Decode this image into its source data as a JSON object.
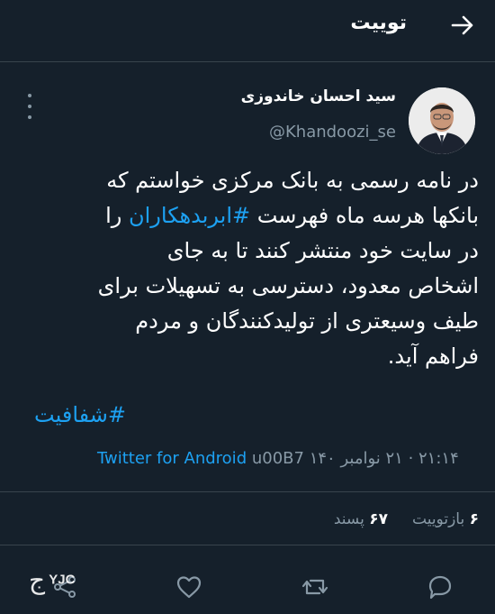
{
  "header": {
    "title": "توییت",
    "back_icon": "arrow-right-icon"
  },
  "author": {
    "display_name": "سید احسان خاندوزی",
    "handle": "@Khandoozi_se"
  },
  "tweet": {
    "line1": "در نامه رسمی به بانک مرکزی خواستم که",
    "line2_before": "بانکها هرسه ماه فهرست ",
    "line2_hashtag": "#ابربدهکاران",
    "line2_after": " را",
    "line3": "در سایت خود منتشر کنند تا به جای",
    "line4": "اشخاص معدود، دسترسی به تسهیلات برای",
    "line5": "طیف وسیعتری از تولیدکنندگان و مردم",
    "line6": "فراهم آید.",
    "hashtag2": "#شفافیت"
  },
  "meta": {
    "datetime": "۲۱:۱۴ · ۲۱ نوامبر ۱۴۰",
    "separator": "u00B7",
    "source": "Twitter for Android"
  },
  "stats": {
    "retweets_count": "۶",
    "retweets_label": "بازتوییت",
    "likes_count": "۶۷",
    "likes_label": "پسند"
  },
  "watermark": {
    "latin": "YJC",
    "arabic": "ج"
  },
  "colors": {
    "background": "#15202b",
    "accent": "#1da1f2",
    "muted": "#8899a6",
    "divider": "#38444d"
  }
}
